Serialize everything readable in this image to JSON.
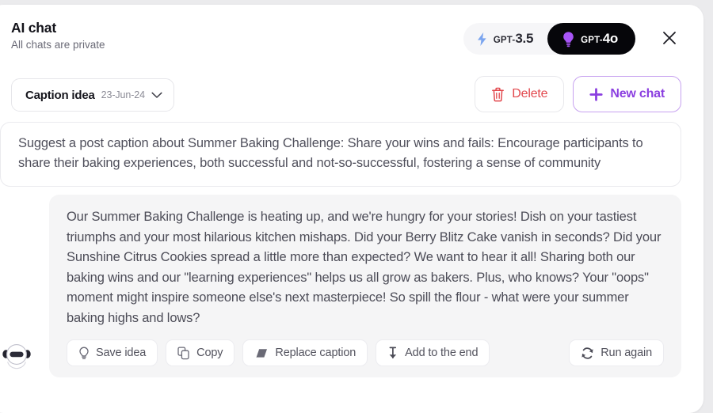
{
  "header": {
    "title": "AI chat",
    "subtitle": "All chats are private",
    "close_icon": "close-icon"
  },
  "model_toggle": {
    "options": [
      {
        "prefix": "GPT-",
        "version": "3.5",
        "icon": "lightning-bolt-icon",
        "icon_color": "#7ba5ef",
        "active": false
      },
      {
        "prefix": "GPT-",
        "version": "4o",
        "icon": "lightbulb-icon",
        "icon_color": "#a855f7",
        "active": true
      }
    ]
  },
  "toolbar": {
    "dropdown": {
      "title": "Caption idea",
      "date": "23-Jun-24",
      "icon": "chevron-down-icon"
    },
    "delete_label": "Delete",
    "delete_icon": "trash-icon",
    "delete_color": "#e2484d",
    "new_chat_label": "New chat",
    "new_chat_icon": "plus-icon",
    "new_chat_color": "#8b3fe0"
  },
  "prompt": {
    "text": "Suggest a post caption about Summer Baking Challenge: Share your wins and fails: Encourage participants to share their baking experiences, both successful and not-so-successful, fostering a sense of community"
  },
  "response": {
    "avatar_icon": "bot-avatar-icon",
    "text": "Our Summer Baking Challenge is heating up, and we're hungry for your stories!  Dish on your tastiest triumphs and your most hilarious kitchen mishaps.  Did your Berry Blitz Cake vanish in seconds? Did your Sunshine Citrus Cookies spread a little more than expected? We want to hear it all! Sharing both our baking wins and our \"learning experiences\"  helps us all grow as bakers.  Plus, who knows?  Your \"oops\" moment might inspire someone else's next masterpiece! So spill the flour - what were your summer baking highs and lows?",
    "actions": [
      {
        "label": "Save idea",
        "icon": "lightbulb-icon"
      },
      {
        "label": "Copy",
        "icon": "copy-icon"
      },
      {
        "label": "Replace caption",
        "icon": "eraser-icon"
      },
      {
        "label": "Add to the end",
        "icon": "arrow-down-to-line-icon"
      }
    ],
    "run_again_label": "Run again",
    "run_again_icon": "refresh-icon"
  }
}
